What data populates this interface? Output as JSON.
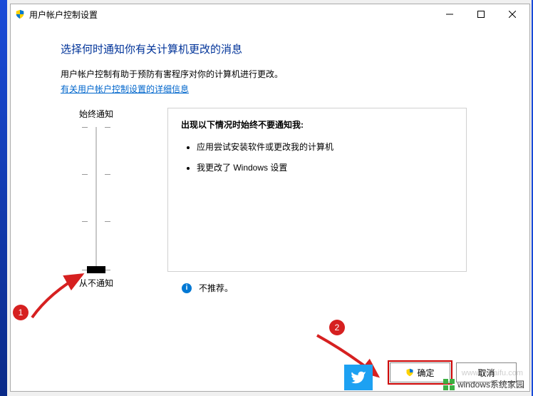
{
  "titlebar": {
    "title": "用户帐户控制设置"
  },
  "content": {
    "heading": "选择何时通知你有关计算机更改的消息",
    "subtext": "用户帐户控制有助于预防有害程序对你的计算机进行更改。",
    "link": "有关用户帐户控制设置的详细信息"
  },
  "slider": {
    "top_label": "始终通知",
    "bottom_label": "从不通知",
    "level": 0,
    "levels": 4
  },
  "infobox": {
    "title": "出现以下情况时始终不要通知我:",
    "items": [
      "应用尝试安装软件或更改我的计算机",
      "我更改了 Windows 设置"
    ],
    "recommendation": "不推荐。"
  },
  "buttons": {
    "ok": "确定",
    "cancel": "取消"
  },
  "annotations": {
    "badge1": "1",
    "badge2": "2"
  },
  "watermark": {
    "brand": "windows系统家园",
    "url": "www.ruihaifu.com"
  }
}
